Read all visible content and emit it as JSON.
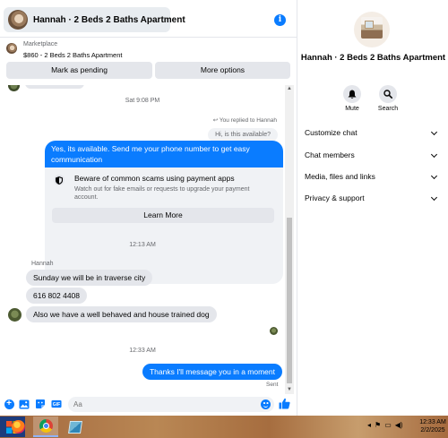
{
  "header": {
    "title": "Hannah · 2 Beds 2 Baths Apartment",
    "info_icon": "info-icon"
  },
  "marketplace": {
    "label": "Marketplace",
    "listing": "$860 - 2 Beds 2 Baths Apartment",
    "pending_button": "Mark as pending",
    "more_button": "More options"
  },
  "messages": {
    "timestamp_1": "Sat 9:08 PM",
    "replied_note": "You replied to Hannah",
    "quoted_text": "Hi, is this available?",
    "reply_text": "Yes, its available. Send me your phone number to get easy communication",
    "scam_card": {
      "title": "Beware of common scams using payment apps",
      "subtitle": "Watch out for fake emails or requests to upgrade your payment account.",
      "button": "Learn More"
    },
    "timestamp_2": "12:13 AM",
    "sender_name": "Hannah",
    "incoming": [
      "Sunday we will be in traverse city",
      "616 802 4408",
      "Also we have a well behaved and house trained dog"
    ],
    "timestamp_3": "12:33 AM",
    "outgoing_last": "Thanks I'll message you in a moment",
    "status": "Sent"
  },
  "composer": {
    "placeholder": "Aa"
  },
  "details": {
    "name": "Hannah · 2 Beds 2 Baths Apartment",
    "mute_label": "Mute",
    "search_label": "Search",
    "menu": [
      "Customize chat",
      "Chat members",
      "Media, files and links",
      "Privacy & support"
    ]
  },
  "taskbar": {
    "time": "12:33 AM",
    "date": "2/2/2025"
  },
  "colors": {
    "accent": "#0a7cff",
    "bubble_gray": "#e4e6eb",
    "panel_gray": "#f0f2f5"
  }
}
